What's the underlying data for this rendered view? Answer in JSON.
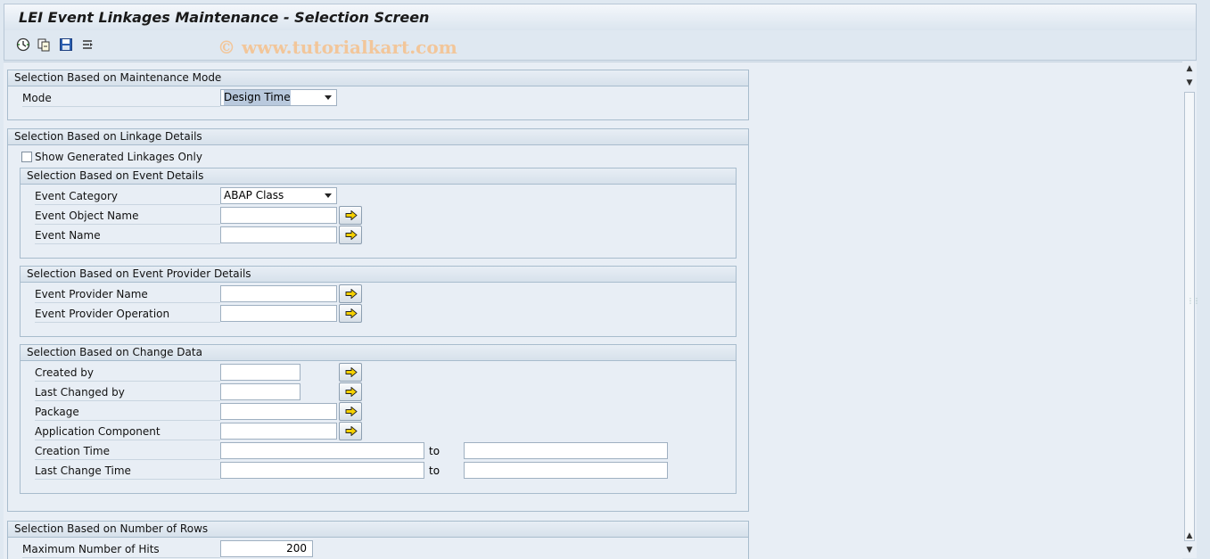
{
  "window": {
    "title": "LEI Event Linkages Maintenance - Selection Screen",
    "watermark": "© www.tutorialkart.com"
  },
  "toolbar": {
    "icons": [
      "execute-icon",
      "get-variant-icon",
      "save-variant-icon",
      "dynamic-selections-icon"
    ]
  },
  "blocks": {
    "mode": {
      "title": "Selection Based on Maintenance Mode",
      "mode_label": "Mode",
      "mode_value": "Design Time"
    },
    "linkage": {
      "title": "Selection Based on Linkage Details",
      "generated_only_label": "Show Generated Linkages Only",
      "generated_only_checked": false,
      "event": {
        "title": "Selection Based on Event Details",
        "category_label": "Event  Category",
        "category_value": "ABAP Class",
        "object_name_label": "Event Object Name",
        "object_name_value": "",
        "event_name_label": "Event Name",
        "event_name_value": ""
      },
      "provider": {
        "title": "Selection Based on Event Provider Details",
        "name_label": "Event Provider Name",
        "name_value": "",
        "operation_label": "Event Provider Operation",
        "operation_value": ""
      },
      "change": {
        "title": "Selection Based on Change Data",
        "created_by_label": "Created by",
        "last_changed_by_label": "Last Changed by",
        "package_label": "Package",
        "app_component_label": "Application Component",
        "creation_time_label": "Creation Time",
        "last_change_time_label": "Last Change Time",
        "to_label": "to"
      }
    },
    "rows": {
      "title": "Selection Based on Number of Rows",
      "max_hits_label": "Maximum Number of Hits",
      "max_hits_value": "200"
    }
  },
  "colors": {
    "background": "#dfe8f1",
    "header": "#d7e1eb",
    "button_arrow": "#f5d000"
  }
}
